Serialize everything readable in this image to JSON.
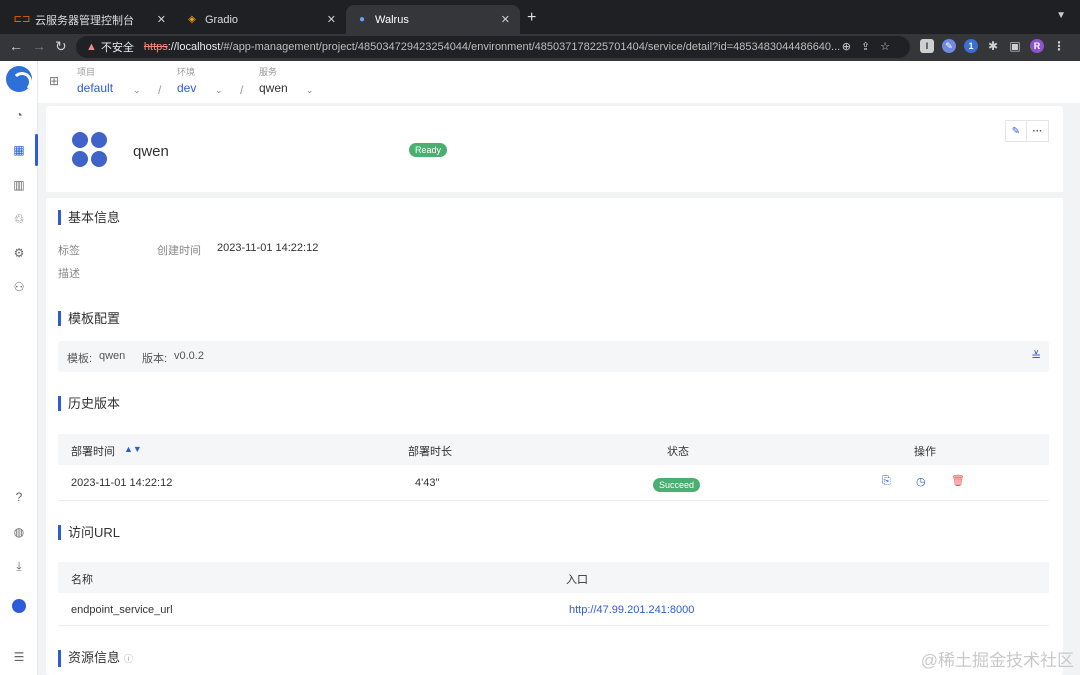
{
  "browser": {
    "tabs": [
      {
        "title": "云服务器管理控制台",
        "active": false
      },
      {
        "title": "Gradio",
        "active": false
      },
      {
        "title": "Walrus",
        "active": true
      }
    ],
    "new_tab": "+",
    "security_warning": "不安全",
    "url_scheme": "https",
    "url_host": "://localhost",
    "url_path": "/#/app-management/project/485034729423254044/environment/485037178225701404/service/detail?id=4853483044486640...",
    "profile_initial": "R"
  },
  "breadcrumb": {
    "project": {
      "caption": "项目",
      "value": "default"
    },
    "environment": {
      "caption": "环境",
      "value": "dev"
    },
    "service": {
      "caption": "服务",
      "value": "qwen"
    },
    "separator": "/"
  },
  "service": {
    "name": "qwen",
    "status": "Ready"
  },
  "basic_info": {
    "title": "基本信息",
    "tags_label": "标签",
    "created_label": "创建时间",
    "created_value": "2023-11-01 14:22:12",
    "desc_label": "描述"
  },
  "template_config": {
    "title": "模板配置",
    "template_label": "模板:",
    "template_value": "qwen",
    "version_label": "版本:",
    "version_value": "v0.0.2"
  },
  "history": {
    "title": "历史版本",
    "columns": [
      "部署时间",
      "部署时长",
      "状态",
      "操作"
    ],
    "rows": [
      {
        "time": "2023-11-01 14:22:12",
        "duration": "4'43\"",
        "status": "Succeed"
      }
    ]
  },
  "access_url": {
    "title": "访问URL",
    "columns": [
      "名称",
      "入口"
    ],
    "rows": [
      {
        "name": "endpoint_service_url",
        "url": "http://47.99.201.241:8000"
      }
    ]
  },
  "resources": {
    "title": "资源信息"
  },
  "watermark": "@稀土掘金技术社区",
  "colors": {
    "accent": "#2e5bd8",
    "success": "#4caf72",
    "danger": "#e05c5c"
  }
}
